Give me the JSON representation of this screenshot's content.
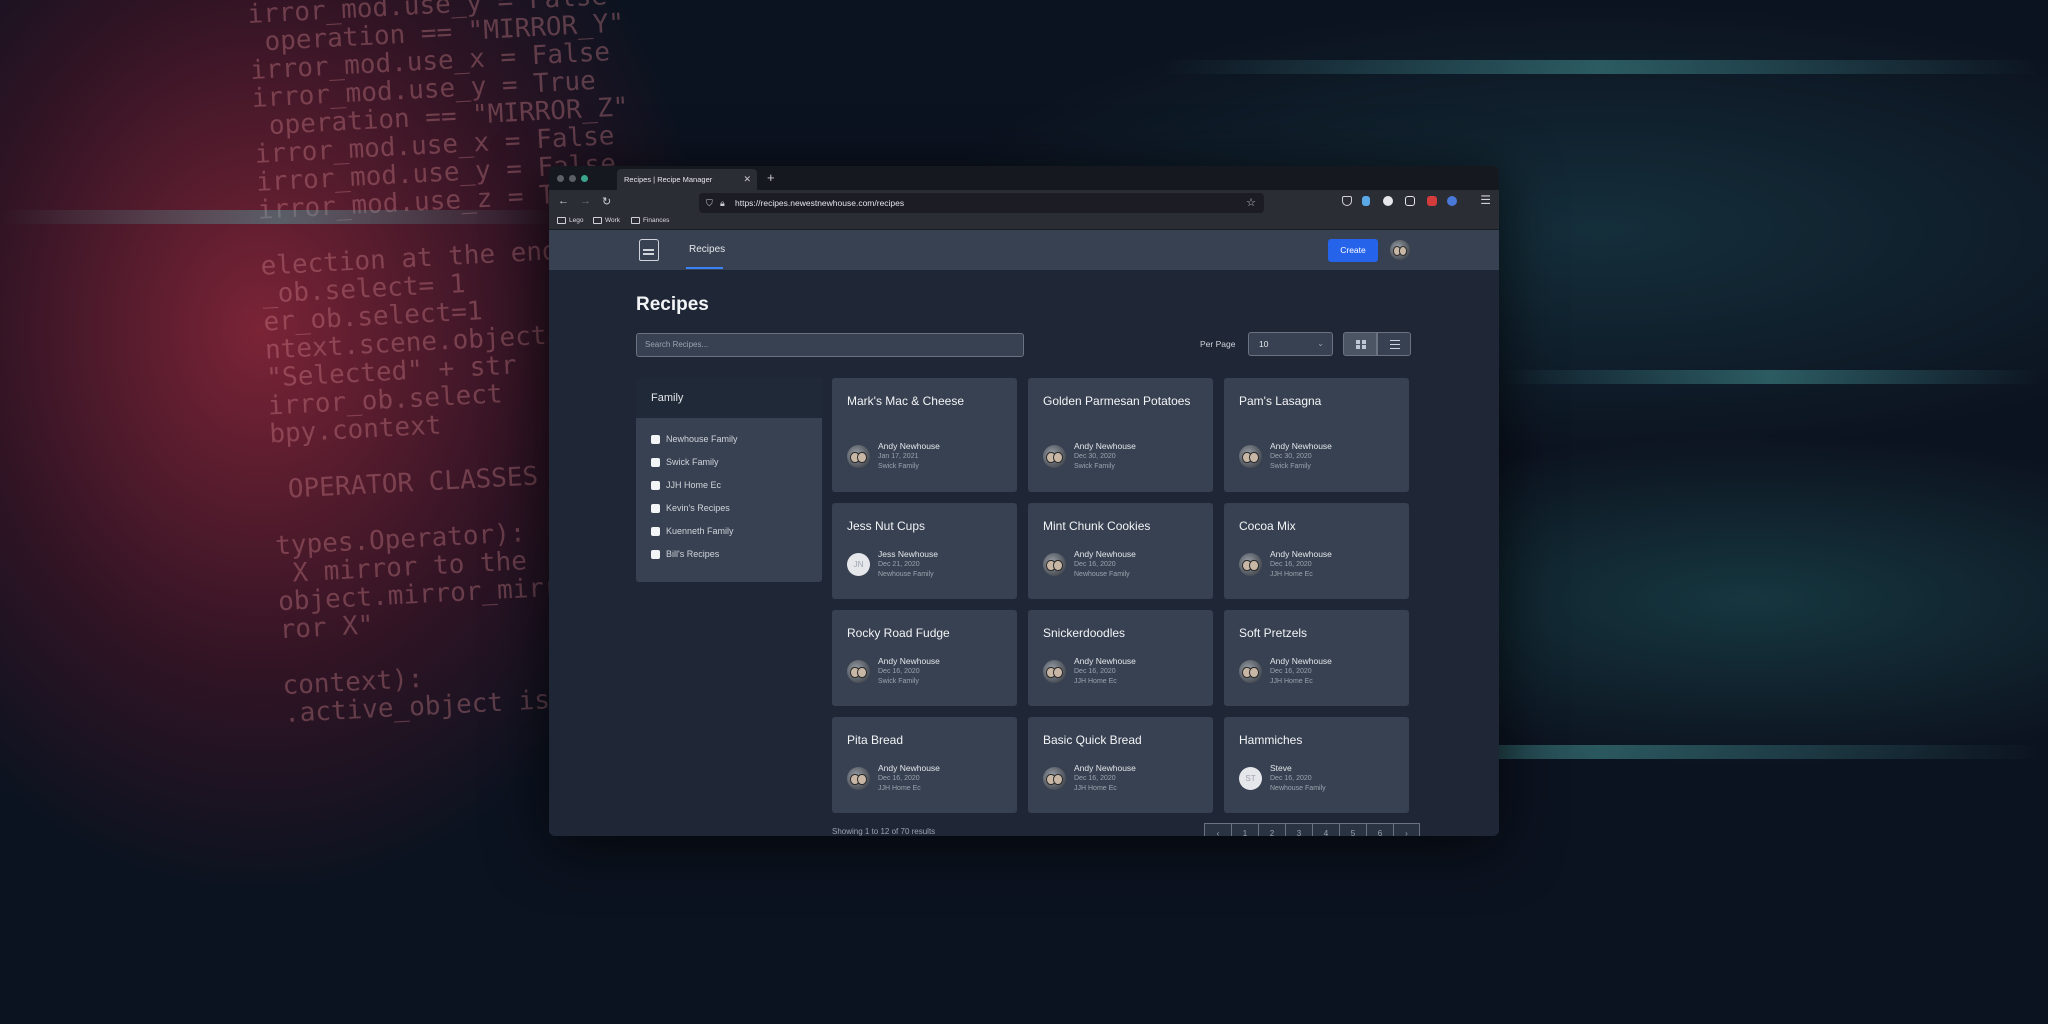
{
  "browser": {
    "tab_title": "Recipes | Recipe Manager",
    "tab_close": "✕",
    "new_tab": "+",
    "back": "←",
    "forward": "→",
    "reload": "↻",
    "url": "https://recipes.newestnewhouse.com/recipes",
    "bookmarks": [
      "Lego",
      "Work",
      "Finances"
    ]
  },
  "header": {
    "nav_recipes": "Recipes",
    "create_label": "Create"
  },
  "main": {
    "title": "Recipes",
    "search_placeholder": "Search Recipes...",
    "per_page_label": "Per Page",
    "per_page_value": "10",
    "per_page_chevron": "⌄"
  },
  "filter": {
    "heading": "Family",
    "options": [
      "Newhouse Family",
      "Swick Family",
      "JJH Home Ec",
      "Kevin's Recipes",
      "Kuenneth Family",
      "Bill's Recipes"
    ]
  },
  "recipes": [
    {
      "title": "Mark's Mac & Cheese",
      "author": "Andy Newhouse",
      "date": "Jan 17, 2021",
      "family": "Swick Family"
    },
    {
      "title": "Golden Parmesan Potatoes",
      "author": "Andy Newhouse",
      "date": "Dec 30, 2020",
      "family": "Swick Family"
    },
    {
      "title": "Pam's Lasagna",
      "author": "Andy Newhouse",
      "date": "Dec 30, 2020",
      "family": "Swick Family"
    },
    {
      "title": "Jess Nut Cups",
      "author": "Jess Newhouse",
      "date": "Dec 21, 2020",
      "family": "Newhouse Family",
      "initials": "JN"
    },
    {
      "title": "Mint Chunk Cookies",
      "author": "Andy Newhouse",
      "date": "Dec 16, 2020",
      "family": "Newhouse Family"
    },
    {
      "title": "Cocoa Mix",
      "author": "Andy Newhouse",
      "date": "Dec 16, 2020",
      "family": "JJH Home Ec"
    },
    {
      "title": "Rocky Road Fudge",
      "author": "Andy Newhouse",
      "date": "Dec 16, 2020",
      "family": "Swick Family"
    },
    {
      "title": "Snickerdoodles",
      "author": "Andy Newhouse",
      "date": "Dec 16, 2020",
      "family": "JJH Home Ec"
    },
    {
      "title": "Soft Pretzels",
      "author": "Andy Newhouse",
      "date": "Dec 16, 2020",
      "family": "JJH Home Ec"
    },
    {
      "title": "Pita Bread",
      "author": "Andy Newhouse",
      "date": "Dec 16, 2020",
      "family": "JJH Home Ec"
    },
    {
      "title": "Basic Quick Bread",
      "author": "Andy Newhouse",
      "date": "Dec 16, 2020",
      "family": "JJH Home Ec"
    },
    {
      "title": "Hammiches",
      "author": "Steve",
      "date": "Dec 16, 2020",
      "family": "Newhouse Family",
      "initials": "ST"
    }
  ],
  "footer": {
    "results_text": "Showing 1 to 12 of 70 results",
    "pages": [
      "‹",
      "1",
      "2",
      "3",
      "4",
      "5",
      "6",
      "›"
    ]
  },
  "colors": {
    "accent": "#2563eb",
    "surface": "#374151",
    "background": "#1f2737"
  }
}
